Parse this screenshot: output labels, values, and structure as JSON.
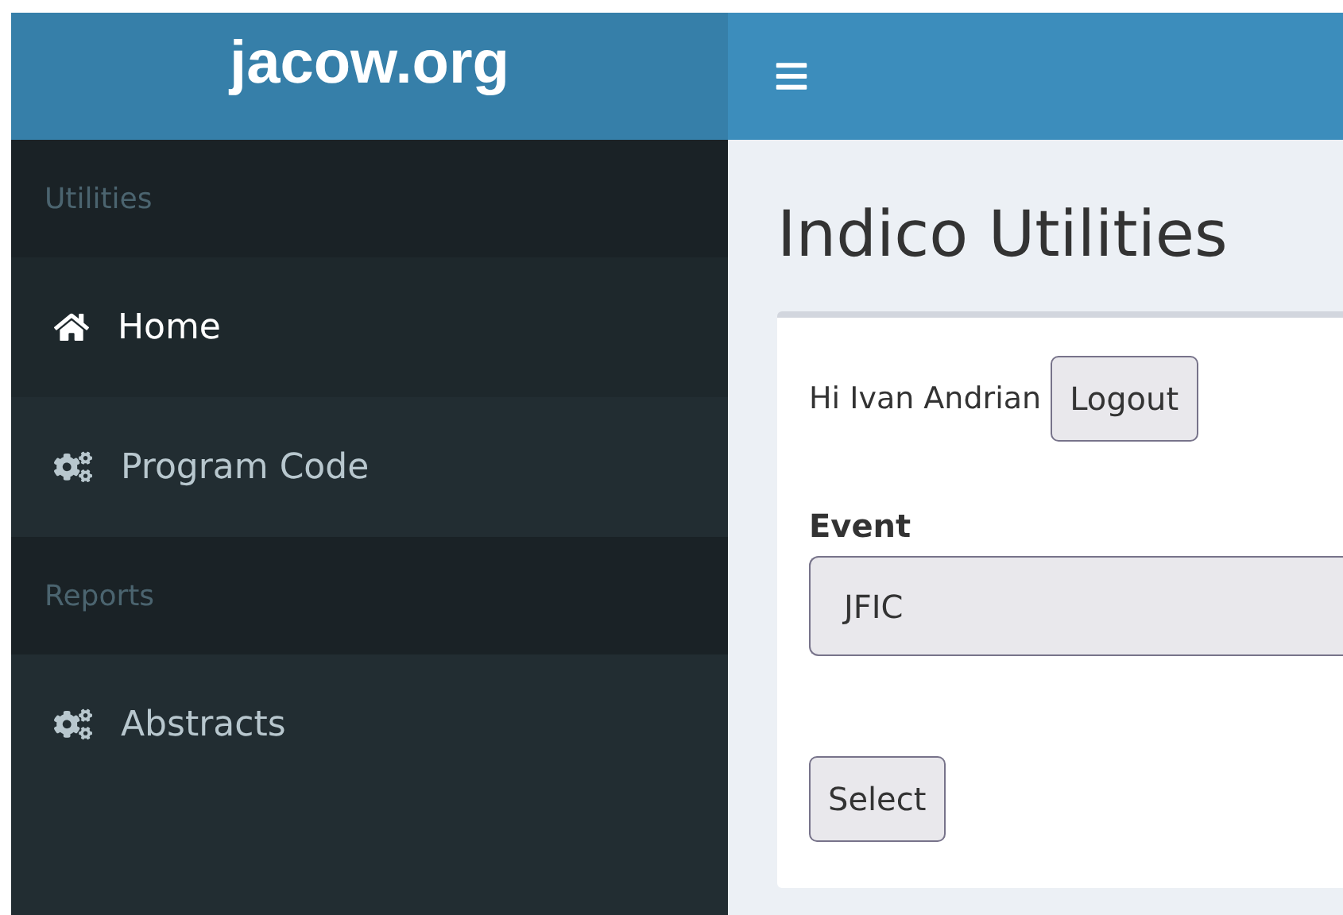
{
  "logo": "jacow.org",
  "sidebar": {
    "sections": [
      {
        "header": "Utilities",
        "items": [
          {
            "label": "Home",
            "kind": "home",
            "selected": true
          },
          {
            "label": "Program Code",
            "kind": "tool",
            "selected": false
          }
        ]
      },
      {
        "header": "Reports",
        "items": [
          {
            "label": "Abstracts",
            "kind": "tool",
            "selected": false
          }
        ]
      }
    ]
  },
  "page_title": "Indico Utilities",
  "greeting": "Hi Ivan Andrian",
  "logout_button": "Logout",
  "event_field": {
    "label": "Event",
    "value": "JFIC"
  },
  "select_button": "Select"
}
